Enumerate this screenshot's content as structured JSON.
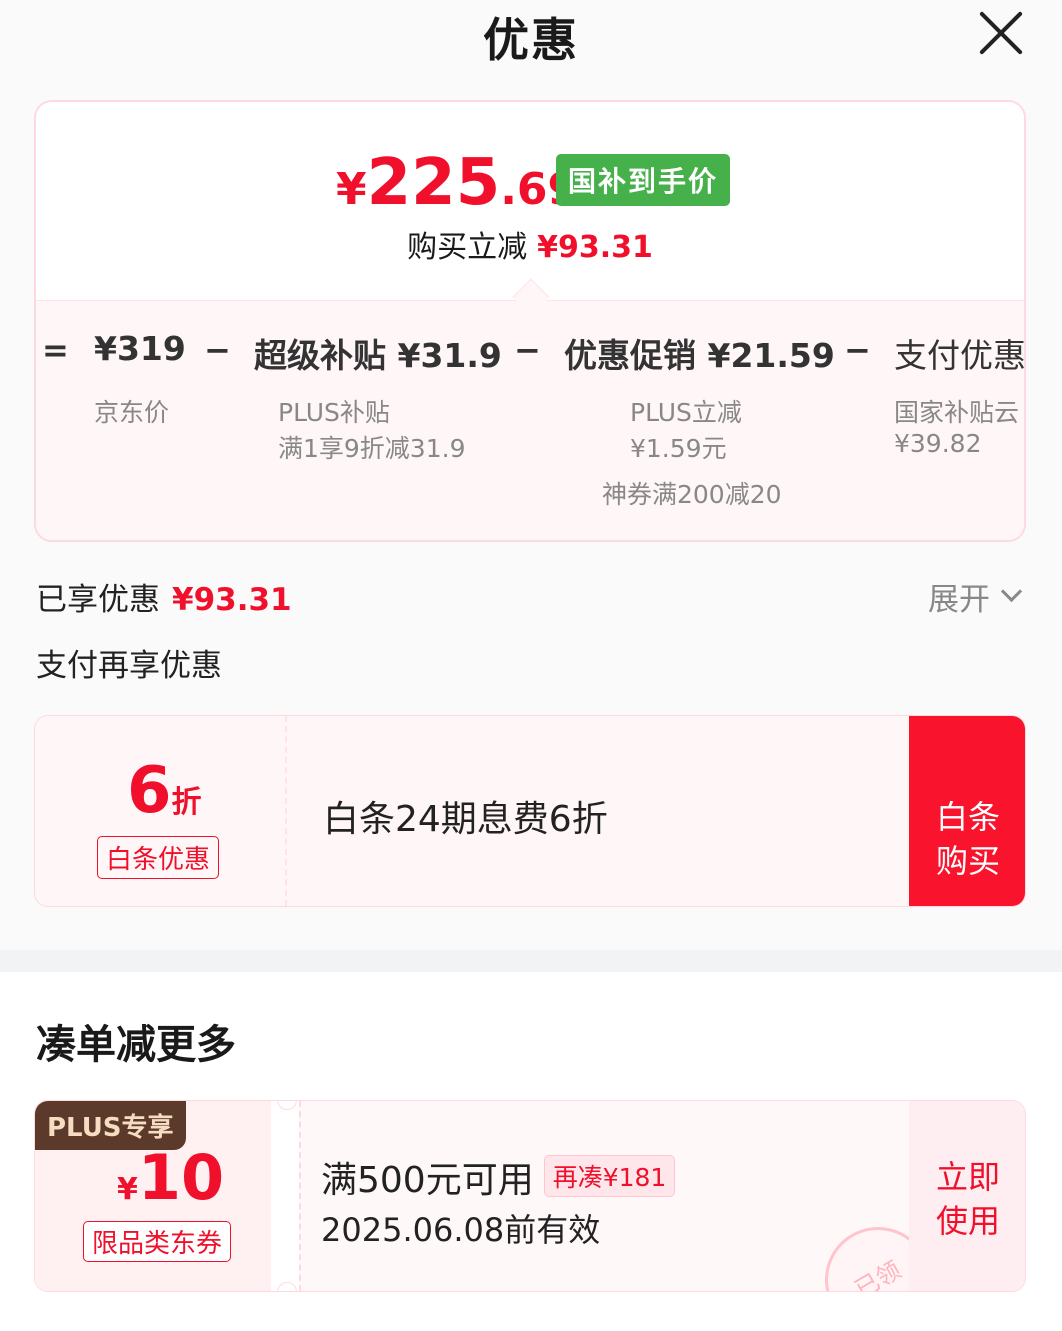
{
  "header": {
    "title": "优惠"
  },
  "summary": {
    "price_symbol": "¥",
    "price_int": "225",
    "price_dec": ".69",
    "tag": "国补到手价",
    "reduce_label": "购买立减",
    "reduce_amount": "¥93.31"
  },
  "breakdown": {
    "eq": "=",
    "minus": "−",
    "items": [
      {
        "value": "¥319",
        "sub1": "京东价",
        "sub2": "",
        "sub3": ""
      },
      {
        "value": "超级补贴 ¥31.9",
        "sub1": "PLUS补贴",
        "sub2": "满1享9折减31.9",
        "sub3": ""
      },
      {
        "value": "优惠促销 ¥21.59",
        "sub1": "PLUS立减",
        "sub2": "¥1.59元",
        "sub3": "神券满200减20"
      },
      {
        "value": "支付优惠",
        "sub1": "国家补贴云",
        "sub2": "¥39.82",
        "sub3": ""
      }
    ]
  },
  "enjoyed": {
    "label": "已享优惠",
    "amount": "¥93.31",
    "expand": "展开"
  },
  "pay_section": {
    "title": "支付再享优惠"
  },
  "baitiao": {
    "discount_num": "6",
    "discount_unit": "折",
    "badge": "白条优惠",
    "desc": "白条24期息费6折",
    "button_line1": "白条",
    "button_line2": "购买"
  },
  "bundle": {
    "title": "凑单减更多"
  },
  "coupon": {
    "plus": "PLUS专享",
    "symbol": "¥",
    "amount": "10",
    "badge": "限品类东券",
    "condition": "满500元可用",
    "tag": "再凑¥181",
    "expiry": "2025.06.08前有效",
    "button_line1": "立即",
    "button_line2": "使用",
    "stamp": "已领"
  },
  "colors": {
    "accent": "#f0102c",
    "green": "#46b04a",
    "plus_brown": "#5b3a2c"
  }
}
